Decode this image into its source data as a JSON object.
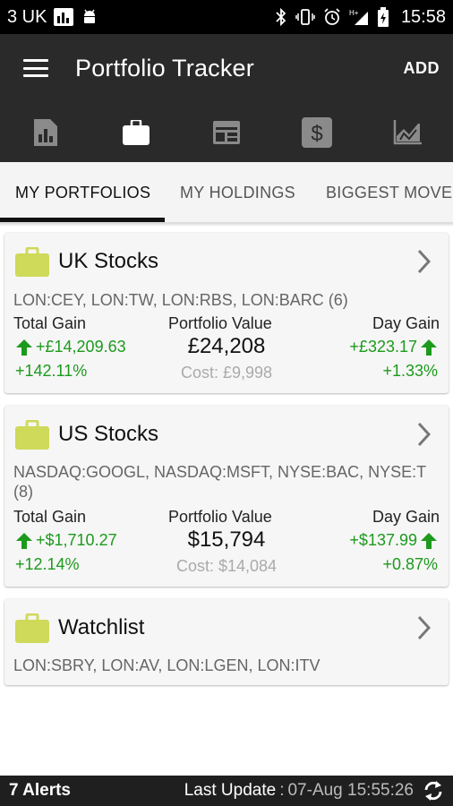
{
  "status_bar": {
    "carrier": "3 UK",
    "network": "H",
    "time": "15:58",
    "icons": [
      "signal-chart-icon",
      "android-icon",
      "bluetooth-icon",
      "vibrate-icon",
      "alarm-icon",
      "signal-strength-icon",
      "battery-charging-icon"
    ]
  },
  "app_bar": {
    "title": "Portfolio Tracker",
    "add_label": "ADD"
  },
  "icon_tabs": [
    {
      "icon": "report-icon",
      "active": false
    },
    {
      "icon": "briefcase-icon",
      "active": true
    },
    {
      "icon": "calendar-table-icon",
      "active": false
    },
    {
      "icon": "dollar-icon",
      "active": false
    },
    {
      "icon": "area-chart-icon",
      "active": false
    }
  ],
  "tabs": [
    {
      "label": "MY PORTFOLIOS",
      "active": true
    },
    {
      "label": "MY HOLDINGS",
      "active": false
    },
    {
      "label": "BIGGEST MOVERS",
      "active": false
    }
  ],
  "labels": {
    "total_gain": "Total Gain",
    "portfolio_value": "Portfolio Value",
    "day_gain": "Day Gain"
  },
  "portfolios": [
    {
      "name": "UK Stocks",
      "symbols": "LON:CEY, LON:TW, LON:RBS, LON:BARC (6)",
      "total_gain": "+£14,209.63",
      "total_gain_pct": "+142.11%",
      "value": "£24,208",
      "cost": "Cost: £9,998",
      "day_gain": "+£323.17",
      "day_gain_pct": "+1.33%"
    },
    {
      "name": "US Stocks",
      "symbols": "NASDAQ:GOOGL, NASDAQ:MSFT, NYSE:BAC, NYSE:T (8)",
      "total_gain": "+$1,710.27",
      "total_gain_pct": "+12.14%",
      "value": "$15,794",
      "cost": "Cost: $14,084",
      "day_gain": "+$137.99",
      "day_gain_pct": "+0.87%"
    },
    {
      "name": "Watchlist",
      "symbols": "LON:SBRY, LON:AV, LON:LGEN, LON:ITV"
    }
  ],
  "footer": {
    "alerts": "7 Alerts",
    "last_update_label": "Last Update",
    "separator": ":",
    "last_update_time": "07-Aug 15:55:26"
  },
  "colors": {
    "gain_green": "#1c9a1c",
    "briefcase_yellow": "#cfd95a",
    "app_bar": "#2a2a2a"
  }
}
